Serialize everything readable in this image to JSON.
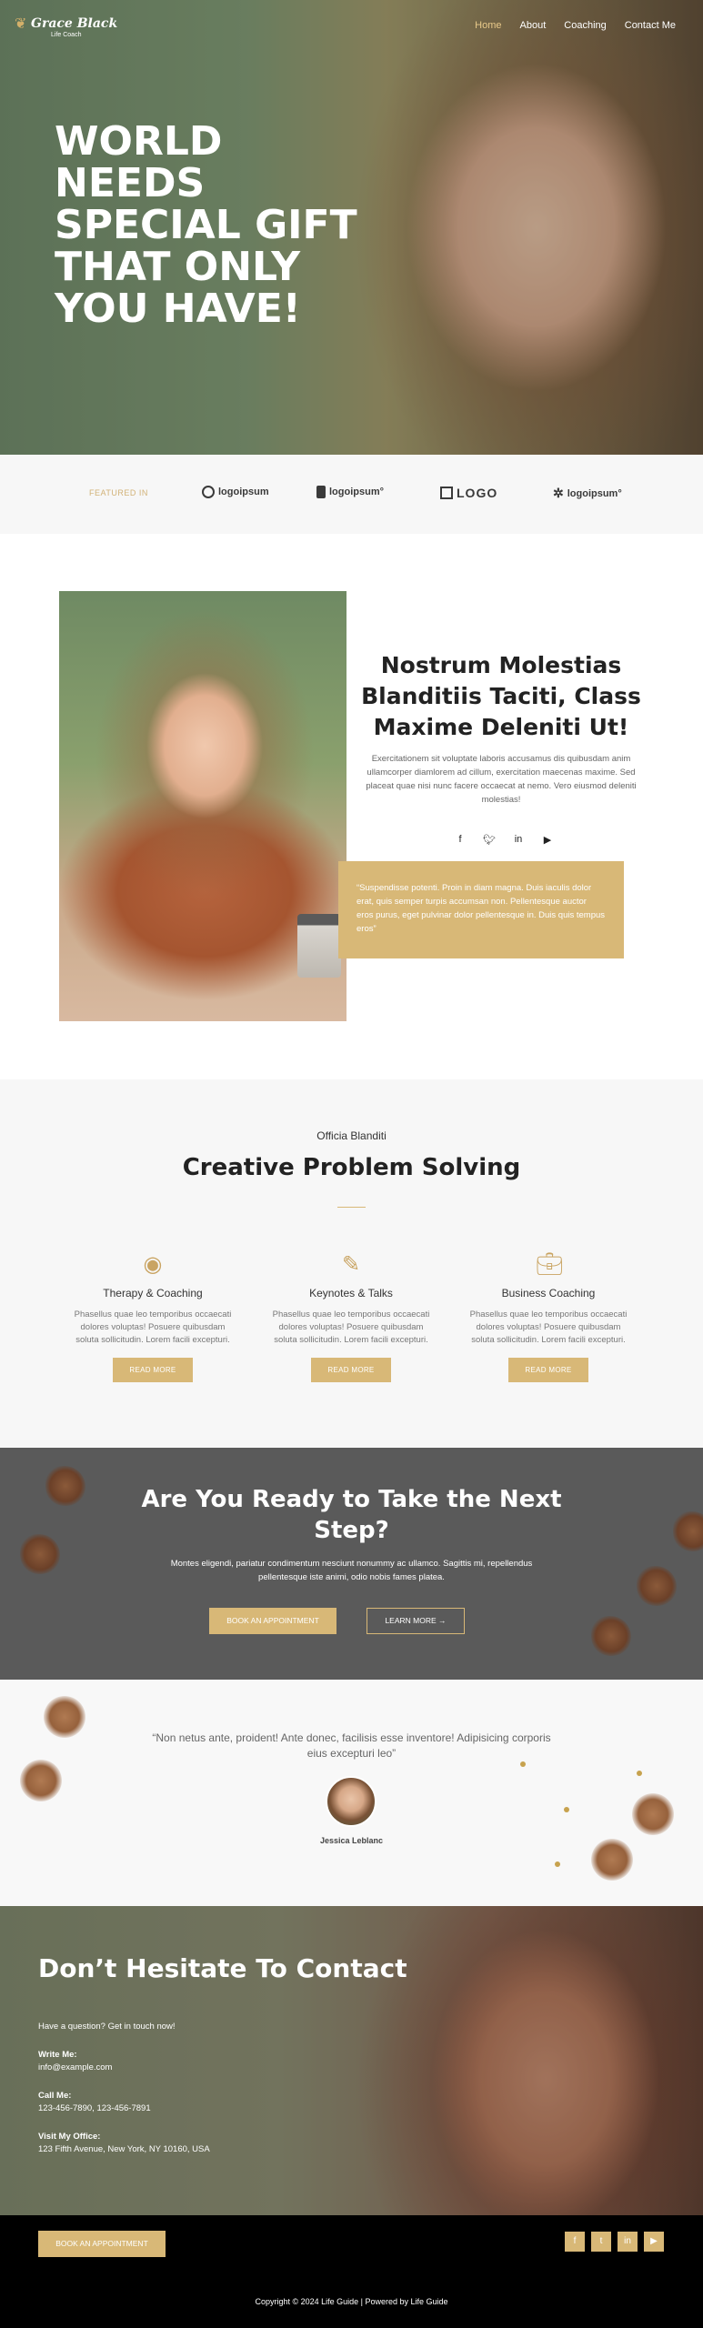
{
  "brand": {
    "name": "Grace Black",
    "tagline": "Life Coach"
  },
  "nav": {
    "items": [
      "Home",
      "About",
      "Coaching",
      "Contact Me"
    ],
    "active": "Home"
  },
  "hero": {
    "title": "WORLD\nNEEDS\nSPECIAL GIFT\nTHAT ONLY\nYOU HAVE!"
  },
  "featured": {
    "label": "FEATURED IN",
    "logos": [
      "logoipsum",
      "logoipsum°",
      "LOGO",
      "logoipsum°"
    ]
  },
  "about": {
    "title": "Nostrum Molestias Blanditiis Taciti, Class Maxime Deleniti Ut!",
    "text": "Exercitationem sit voluptate laboris accusamus dis quibusdam anim ullamcorper diamlorem ad cillum, exercitation maecenas maxime. Sed placeat quae nisi nunc facere occaecat at nemo. Vero eiusmod deleniti molestias!",
    "socials": [
      "facebook-icon",
      "twitter-icon",
      "linkedin-icon",
      "youtube-icon"
    ],
    "quote": "“Suspendisse potenti. Proin in diam magna. Duis iaculis dolor erat, quis semper turpis accumsan non. Pellentesque auctor eros purus, eget pulvinar dolor pellentesque in. Duis quis tempus eros”"
  },
  "services": {
    "kicker": "Officia Blanditi",
    "title": "Creative Problem Solving",
    "cards": [
      {
        "icon": "user-circle-icon",
        "title": "Therapy & Coaching",
        "text": "Phasellus quae leo temporibus occaecati dolores voluptas! Posuere quibusdam soluta sollicitudin. Lorem facili excepturi.",
        "button": "READ MORE"
      },
      {
        "icon": "pencil-icon",
        "title": "Keynotes & Talks",
        "text": "Phasellus quae leo temporibus occaecati dolores voluptas! Posuere quibusdam soluta sollicitudin. Lorem facili excepturi.",
        "button": "READ MORE"
      },
      {
        "icon": "briefcase-clock-icon",
        "title": "Business Coaching",
        "text": "Phasellus quae leo temporibus occaecati dolores voluptas! Posuere quibusdam soluta sollicitudin. Lorem facili excepturi.",
        "button": "READ MORE"
      }
    ]
  },
  "cta": {
    "title": "Are You Ready to Take the Next\nStep?",
    "text": "Montes eligendi, pariatur condimentum nesciunt nonummy ac ullamco. Sagittis mi, repellendus pellentesque iste animi, odio nobis fames platea.",
    "primary": "BOOK AN APPOINTMENT",
    "secondary": "LEARN MORE →"
  },
  "testimonial": {
    "quote": "“Non netus ante, proident! Ante donec, facilisis esse inventore! Adipisicing corporis eius excepturi leo”",
    "name": "Jessica Leblanc"
  },
  "contact": {
    "title": "Don’t Hesitate To Contact",
    "lead": "Have a question? Get in touch now!",
    "write_label": "Write Me:",
    "write_value": "info@example.com",
    "call_label": "Call Me:",
    "call_value": "123-456-7890, 123-456-7891",
    "visit_label": "Visit My Office:",
    "visit_value": "123 Fifth Avenue, New York, NY 10160, USA"
  },
  "footer": {
    "button": "BOOK AN APPOINTMENT",
    "socials": [
      "facebook-icon",
      "twitter-icon",
      "linkedin-icon",
      "youtube-icon"
    ],
    "copyright": "Copyright © 2024 Life Guide | Powered by Life Guide"
  },
  "colors": {
    "accent": "#d8b877",
    "dark": "#5a5a5a",
    "footer": "#000000"
  }
}
